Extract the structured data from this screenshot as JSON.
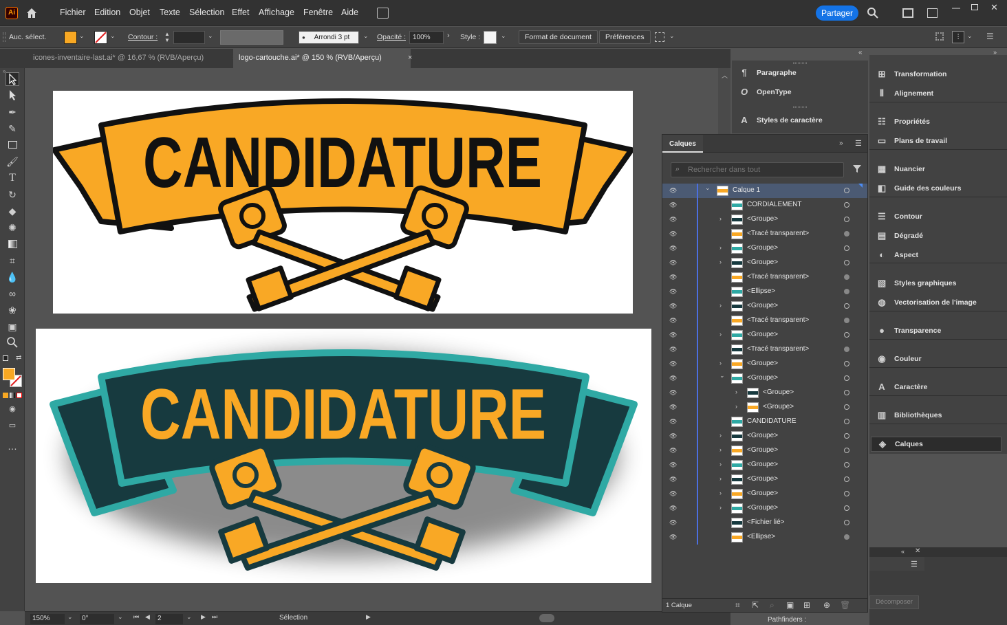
{
  "app": {
    "logo": "Ai"
  },
  "menu": [
    "Fichier",
    "Edition",
    "Objet",
    "Texte",
    "Sélection",
    "Effet",
    "Affichage",
    "Fenêtre",
    "Aide"
  ],
  "share_label": "Partager",
  "controlbar": {
    "selection": "Auc. sélect.",
    "contour_label": "Contour :",
    "brush_value": "Arrondi 3 pt",
    "opacity_label": "Opacité :",
    "opacity_value": "100%",
    "style_label": "Style :",
    "doc_format_btn": "Format de document",
    "preferences_btn": "Préférences"
  },
  "colors": {
    "fill": "#f8a823",
    "accent_orange": "#f9a825",
    "teal_dark": "#173a3f",
    "teal_light": "#2fa9a4"
  },
  "tabs": [
    {
      "label": "icones-inventaire-last.ai* @ 16,67 % (RVB/Aperçu)",
      "active": false
    },
    {
      "label": "logo-cartouche.ai* @ 150 % (RVB/Aperçu)",
      "active": true
    }
  ],
  "artwork": {
    "top_text": "CANDIDATURE",
    "bottom_text": "CANDIDATURE"
  },
  "status": {
    "zoom": "150%",
    "rotation": "0°",
    "artboard": "2",
    "tool": "Sélection"
  },
  "right_panels_col1": [
    {
      "icon": "paragraph-icon",
      "label": "Paragraphe"
    },
    {
      "icon": "opentype-icon",
      "label": "OpenType"
    },
    {
      "icon": "character-styles-icon",
      "label": "Styles de caractère"
    }
  ],
  "right_panels_col2": [
    {
      "icon": "transform-icon",
      "label": "Transformation"
    },
    {
      "icon": "align-icon",
      "label": "Alignement"
    },
    {
      "icon": "properties-icon",
      "label": "Propriétés"
    },
    {
      "icon": "artboards-icon",
      "label": "Plans de travail"
    },
    {
      "icon": "swatches-icon",
      "label": "Nuancier"
    },
    {
      "icon": "color-guide-icon",
      "label": "Guide des couleurs"
    },
    {
      "icon": "stroke-icon",
      "label": "Contour"
    },
    {
      "icon": "gradient-icon",
      "label": "Dégradé"
    },
    {
      "icon": "appearance-icon",
      "label": "Aspect"
    },
    {
      "icon": "graphic-styles-icon",
      "label": "Styles graphiques"
    },
    {
      "icon": "image-trace-icon",
      "label": "Vectorisation de l'image"
    },
    {
      "icon": "transparency-icon",
      "label": "Transparence"
    },
    {
      "icon": "color-icon",
      "label": "Couleur"
    },
    {
      "icon": "character-icon",
      "label": "Caractère"
    },
    {
      "icon": "libraries-icon",
      "label": "Bibliothèques"
    },
    {
      "icon": "layers-icon",
      "label": "Calques"
    }
  ],
  "layers_panel": {
    "title": "Calques",
    "search_placeholder": "Rechercher dans tout",
    "footer_count": "1 Calque",
    "rows": [
      {
        "name": "Calque 1",
        "expand": "open",
        "indent": 0,
        "target": "empty",
        "selected": true
      },
      {
        "name": "CORDIALEMENT",
        "expand": "",
        "indent": 1,
        "target": "empty"
      },
      {
        "name": "<Groupe>",
        "expand": "closed",
        "indent": 1,
        "target": "empty"
      },
      {
        "name": "<Tracé transparent>",
        "expand": "",
        "indent": 1,
        "target": "filled"
      },
      {
        "name": "<Groupe>",
        "expand": "closed",
        "indent": 1,
        "target": "empty"
      },
      {
        "name": "<Groupe>",
        "expand": "closed",
        "indent": 1,
        "target": "empty"
      },
      {
        "name": "<Tracé transparent>",
        "expand": "",
        "indent": 1,
        "target": "filled"
      },
      {
        "name": "<Ellipse>",
        "expand": "",
        "indent": 1,
        "target": "filled"
      },
      {
        "name": "<Groupe>",
        "expand": "closed",
        "indent": 1,
        "target": "empty"
      },
      {
        "name": "<Tracé transparent>",
        "expand": "",
        "indent": 1,
        "target": "filled"
      },
      {
        "name": "<Groupe>",
        "expand": "closed",
        "indent": 1,
        "target": "empty"
      },
      {
        "name": "<Tracé transparent>",
        "expand": "",
        "indent": 1,
        "target": "filled"
      },
      {
        "name": "<Groupe>",
        "expand": "closed",
        "indent": 1,
        "target": "empty"
      },
      {
        "name": "<Groupe>",
        "expand": "open",
        "indent": 1,
        "target": "empty"
      },
      {
        "name": "<Groupe>",
        "expand": "closed",
        "indent": 2,
        "target": "empty"
      },
      {
        "name": "<Groupe>",
        "expand": "closed",
        "indent": 2,
        "target": "empty"
      },
      {
        "name": "CANDIDATURE",
        "expand": "",
        "indent": 1,
        "target": "empty"
      },
      {
        "name": "<Groupe>",
        "expand": "closed",
        "indent": 1,
        "target": "empty"
      },
      {
        "name": "<Groupe>",
        "expand": "closed",
        "indent": 1,
        "target": "empty"
      },
      {
        "name": "<Groupe>",
        "expand": "closed",
        "indent": 1,
        "target": "empty"
      },
      {
        "name": "<Groupe>",
        "expand": "closed",
        "indent": 1,
        "target": "empty"
      },
      {
        "name": "<Groupe>",
        "expand": "closed",
        "indent": 1,
        "target": "empty"
      },
      {
        "name": "<Groupe>",
        "expand": "closed",
        "indent": 1,
        "target": "empty"
      },
      {
        "name": "<Fichier lié>",
        "expand": "",
        "indent": 1,
        "target": "empty"
      },
      {
        "name": "<Ellipse>",
        "expand": "",
        "indent": 1,
        "target": "filled"
      }
    ]
  },
  "pathfinder": {
    "decompose_btn": "Décomposer",
    "label": "Pathfinders :"
  }
}
